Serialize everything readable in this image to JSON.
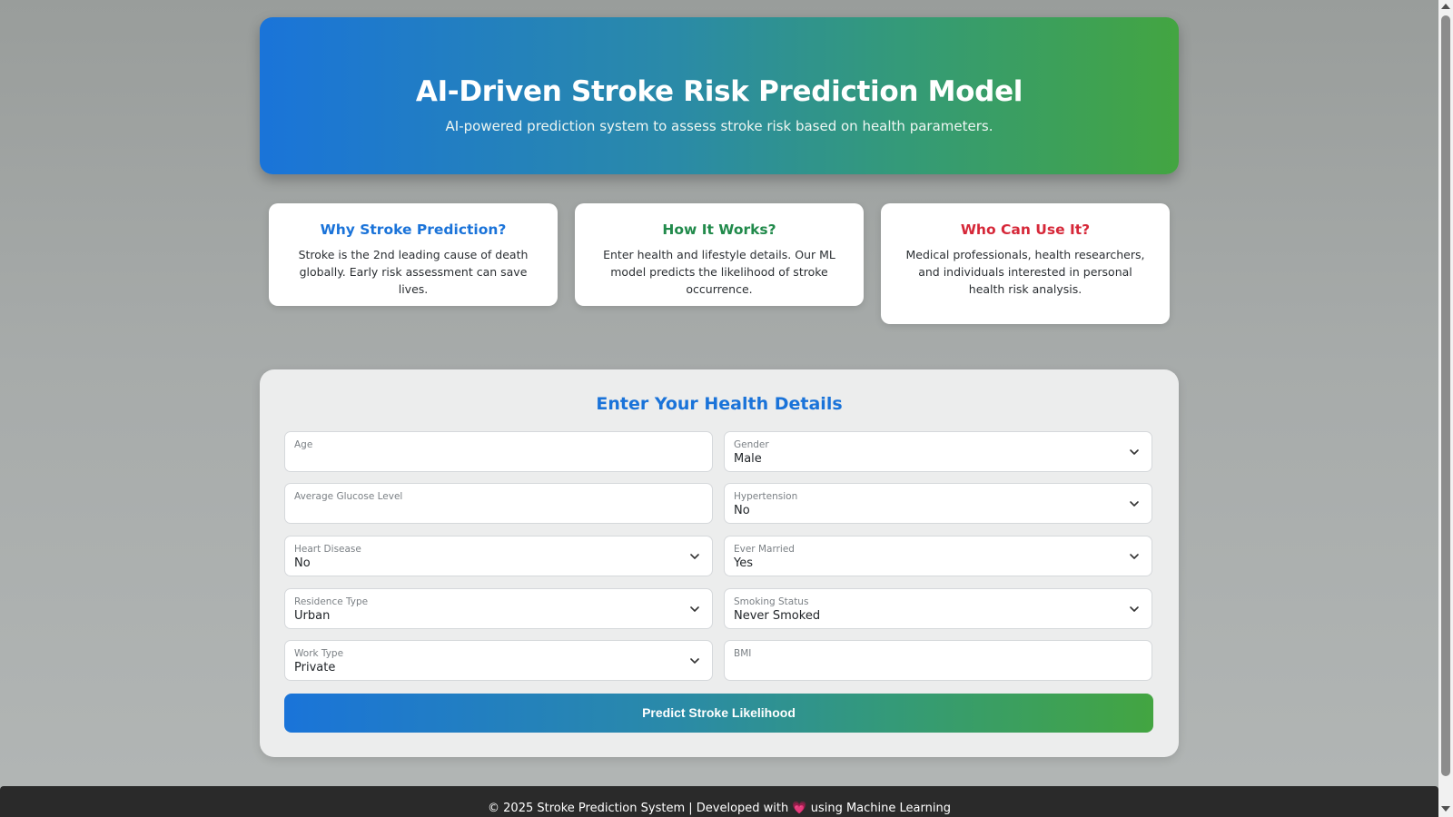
{
  "hero": {
    "title": "AI-Driven Stroke Risk Prediction Model",
    "subtitle": "AI-powered prediction system to assess stroke risk based on health parameters."
  },
  "cards": [
    {
      "title": "Why Stroke Prediction?",
      "text": "Stroke is the 2nd leading cause of death globally. Early risk assessment can save lives.",
      "color": "#1a73d9"
    },
    {
      "title": "How It Works?",
      "text": "Enter health and lifestyle details. Our ML model predicts the likelihood of stroke occurrence.",
      "color": "#218a4b"
    },
    {
      "title": "Who Can Use It?",
      "text": "Medical professionals, health researchers, and individuals interested in personal health risk analysis.",
      "color": "#d62839"
    }
  ],
  "form": {
    "title": "Enter Your Health Details",
    "fields": {
      "age": {
        "label": "Age",
        "value": ""
      },
      "gender": {
        "label": "Gender",
        "value": "Male"
      },
      "glucose": {
        "label": "Average Glucose Level",
        "value": ""
      },
      "hypertension": {
        "label": "Hypertension",
        "value": "No"
      },
      "heart_disease": {
        "label": "Heart Disease",
        "value": "No"
      },
      "ever_married": {
        "label": "Ever Married",
        "value": "Yes"
      },
      "residence": {
        "label": "Residence Type",
        "value": "Urban"
      },
      "smoking": {
        "label": "Smoking Status",
        "value": "Never Smoked"
      },
      "work_type": {
        "label": "Work Type",
        "value": "Private"
      },
      "bmi": {
        "label": "BMI",
        "value": ""
      }
    },
    "submit_label": "Predict Stroke Likelihood"
  },
  "footer": {
    "prefix": "© 2025 Stroke Prediction System | Developed with",
    "heart": "💗",
    "suffix": "using Machine Learning"
  },
  "colors": {
    "accent_blue": "#1a74d9",
    "accent_green": "#43a541",
    "footer_bg": "#2a2a2a"
  },
  "icons": {
    "chevron": "chevron-down-icon",
    "heart": "heart-icon"
  }
}
